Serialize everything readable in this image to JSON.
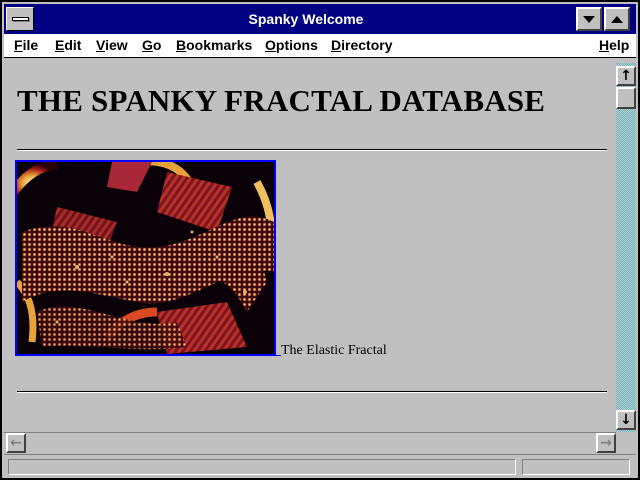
{
  "window": {
    "title": "Spanky Welcome"
  },
  "menubar": {
    "items": [
      {
        "label": "File",
        "mnemonic": "F",
        "rest": "ile"
      },
      {
        "label": "Edit",
        "mnemonic": "E",
        "rest": "dit"
      },
      {
        "label": "View",
        "mnemonic": "V",
        "rest": "iew"
      },
      {
        "label": "Go",
        "mnemonic": "G",
        "rest": "o"
      },
      {
        "label": "Bookmarks",
        "mnemonic": "B",
        "rest": "ookmarks"
      },
      {
        "label": "Options",
        "mnemonic": "O",
        "rest": "ptions"
      },
      {
        "label": "Directory",
        "mnemonic": "D",
        "rest": "irectory"
      },
      {
        "label": "Help",
        "mnemonic": "H",
        "rest": "elp"
      }
    ]
  },
  "page": {
    "heading": "THE SPANKY FRACTAL DATABASE",
    "fractal": {
      "caption": "The Elastic Fractal"
    }
  },
  "statusbar": {
    "status_text": ""
  },
  "colors": {
    "titlebar": "#000080",
    "link_border": "#0000ff",
    "window_bg": "#c0c0c0",
    "scroll_track": "#7fb3b8"
  },
  "icons": {
    "system_menu": "system-menu-icon",
    "minimize": "minimize-icon",
    "maximize": "maximize-icon",
    "scroll_up": "arrow-up-icon",
    "scroll_down": "arrow-down-icon",
    "scroll_left": "arrow-left-icon",
    "scroll_right": "arrow-right-icon"
  }
}
